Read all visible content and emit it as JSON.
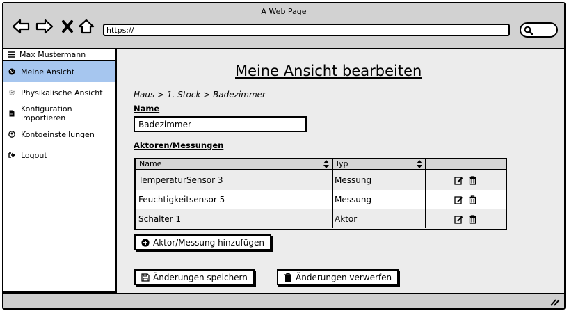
{
  "window": {
    "title": "A Web Page"
  },
  "browser": {
    "url": "https://",
    "icons": [
      "back-arrow-icon",
      "forward-arrow-icon",
      "close-x-icon",
      "home-icon",
      "search-icon"
    ]
  },
  "sidebar": {
    "user": "Max Mustermann",
    "items": [
      {
        "label": "Meine Ansicht",
        "icon": "globe-icon",
        "active": true
      },
      {
        "label": "Physikalische Ansicht",
        "icon": "gear-icon",
        "active": false
      },
      {
        "label": "Konfiguration importieren",
        "icon": "file-icon",
        "active": false
      },
      {
        "label": "Kontoeinstellungen",
        "icon": "user-circle-icon",
        "active": false
      },
      {
        "label": "Logout",
        "icon": "logout-icon",
        "active": false
      }
    ]
  },
  "main": {
    "title": "Meine Ansicht bearbeiten",
    "breadcrumb": "Haus > 1. Stock > Badezimmer",
    "name_label": "Name",
    "name_value": "Badezimmer",
    "section_label": "Aktoren/Messungen",
    "table": {
      "columns": [
        "Name",
        "Typ",
        ""
      ],
      "rows": [
        {
          "name": "TemperaturSensor 3",
          "typ": "Messung"
        },
        {
          "name": "Feuchtigkeitsensor 5",
          "typ": "Messung"
        },
        {
          "name": "Schalter 1",
          "typ": "Aktor"
        }
      ]
    },
    "add_button": "Aktor/Messung hinzufügen",
    "save_button": "Änderungen speichern",
    "discard_button": "Änderungen verwerfen"
  }
}
